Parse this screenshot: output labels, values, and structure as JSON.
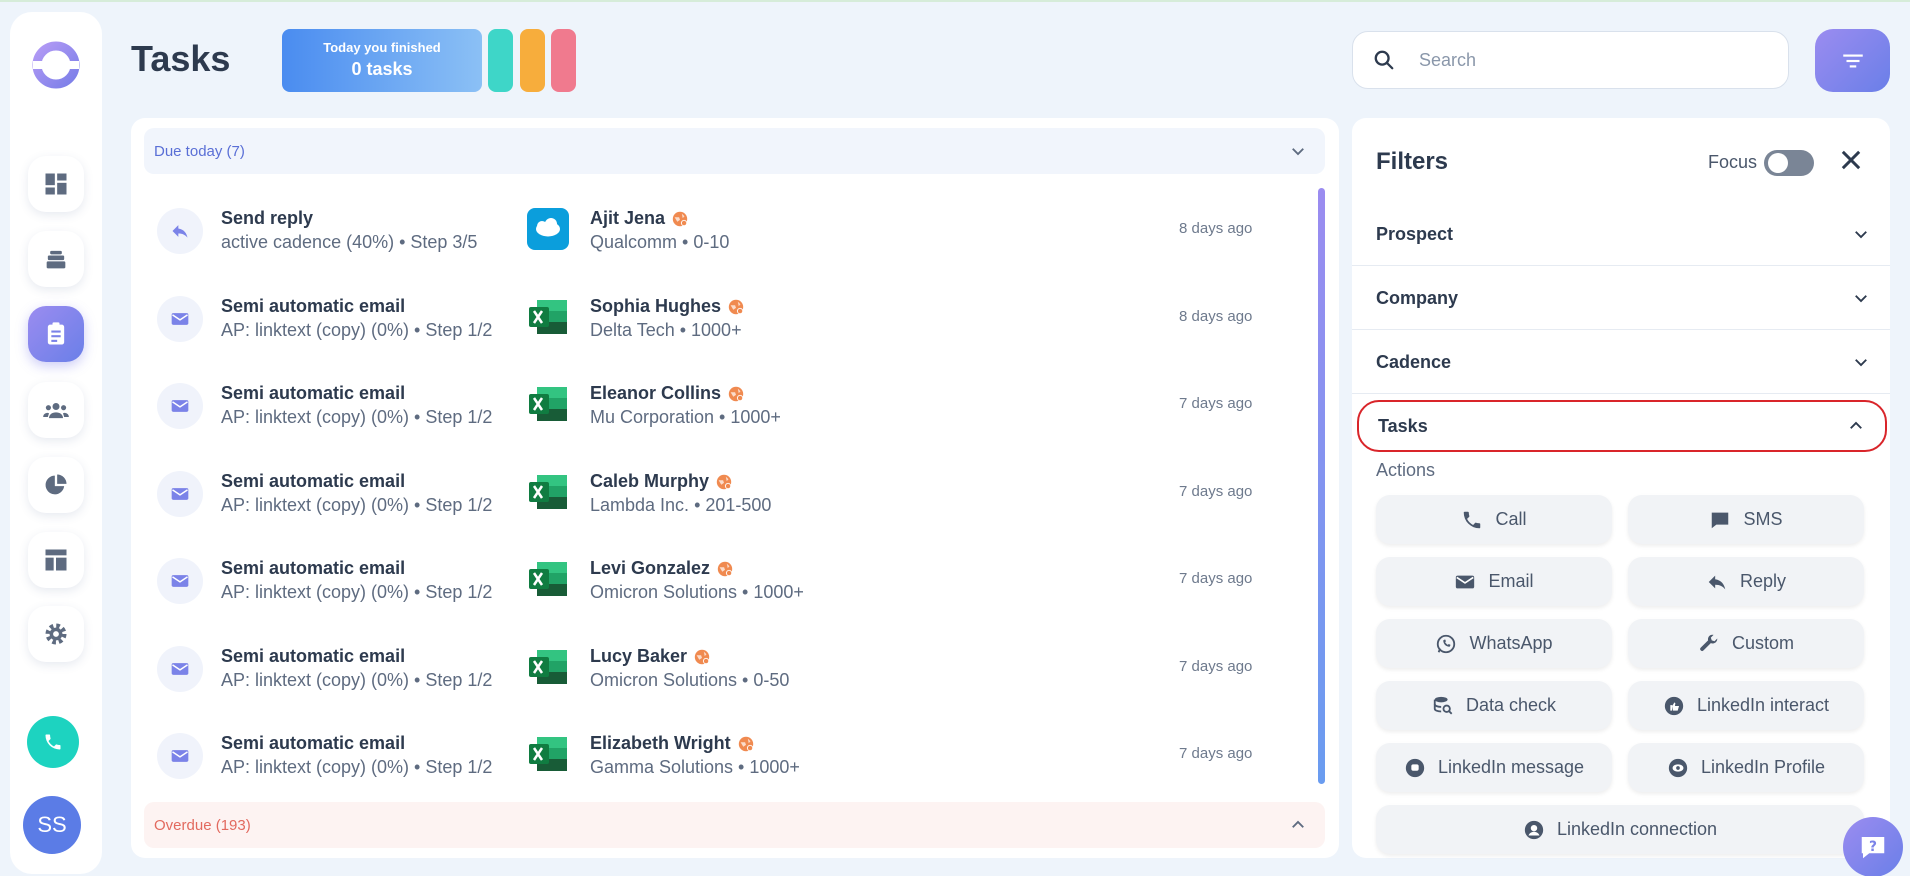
{
  "header": {
    "title": "Tasks",
    "finished_small": "Today you finished",
    "finished_big": "0 tasks",
    "progress_colors": [
      "#3ed6c8",
      "#f7ad3c",
      "#f07a8e"
    ]
  },
  "search": {
    "placeholder": "Search"
  },
  "sidebar": {
    "items": [
      "dashboard",
      "stack",
      "tasks",
      "contacts",
      "reports",
      "templates",
      "settings"
    ],
    "active": "tasks",
    "avatar_initials": "SS"
  },
  "sections": {
    "due": "Due today (7)",
    "overdue": "Overdue (193)"
  },
  "tasks": [
    {
      "type": "reply",
      "title": "Send reply",
      "sub": "active cadence (40%) • Step 3/5",
      "source": "salesforce",
      "name": "Ajit Jena",
      "company": "Qualcomm • 0-10",
      "time": "8 days ago"
    },
    {
      "type": "email",
      "title": "Semi automatic email",
      "sub": "AP: linktext (copy) (0%) • Step 1/2",
      "source": "excel",
      "name": "Sophia Hughes",
      "company": "Delta Tech • 1000+",
      "time": "8 days ago"
    },
    {
      "type": "email",
      "title": "Semi automatic email",
      "sub": "AP: linktext (copy) (0%) • Step 1/2",
      "source": "excel",
      "name": "Eleanor Collins",
      "company": "Mu Corporation • 1000+",
      "time": "7 days ago"
    },
    {
      "type": "email",
      "title": "Semi automatic email",
      "sub": "AP: linktext (copy) (0%) • Step 1/2",
      "source": "excel",
      "name": "Caleb Murphy",
      "company": "Lambda Inc. • 201-500",
      "time": "7 days ago"
    },
    {
      "type": "email",
      "title": "Semi automatic email",
      "sub": "AP: linktext (copy) (0%) • Step 1/2",
      "source": "excel",
      "name": "Levi Gonzalez",
      "company": "Omicron Solutions • 1000+",
      "time": "7 days ago"
    },
    {
      "type": "email",
      "title": "Semi automatic email",
      "sub": "AP: linktext (copy) (0%) • Step 1/2",
      "source": "excel",
      "name": "Lucy Baker",
      "company": "Omicron Solutions • 0-50",
      "time": "7 days ago"
    },
    {
      "type": "email",
      "title": "Semi automatic email",
      "sub": "AP: linktext (copy) (0%) • Step 1/2",
      "source": "excel",
      "name": "Elizabeth Wright",
      "company": "Gamma Solutions • 1000+",
      "time": "7 days ago"
    }
  ],
  "filters": {
    "title": "Filters",
    "focus_label": "Focus",
    "sections": [
      "Prospect",
      "Company",
      "Cadence",
      "Tasks"
    ],
    "actions_label": "Actions",
    "actions": [
      "Call",
      "SMS",
      "Email",
      "Reply",
      "WhatsApp",
      "Custom",
      "Data check",
      "LinkedIn interact",
      "LinkedIn message",
      "LinkedIn Profile",
      "LinkedIn connection"
    ]
  }
}
